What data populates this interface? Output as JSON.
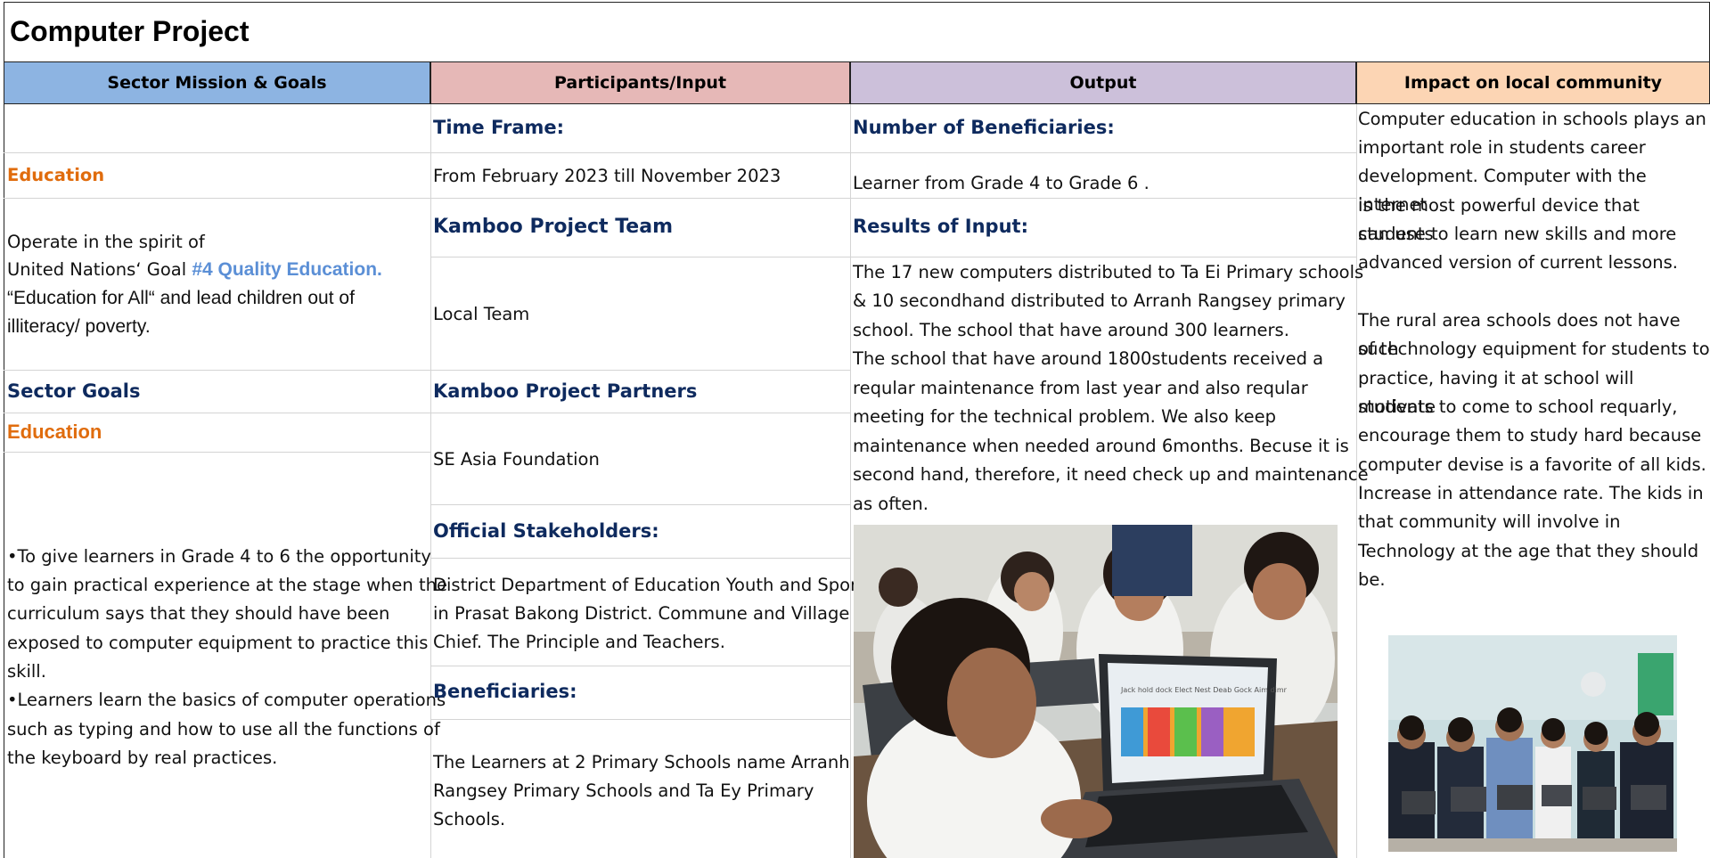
{
  "title": "Computer Project",
  "colors": {
    "header_mission": "#8db4e2",
    "header_participants": "#e6b8b7",
    "header_output": "#ccc0da",
    "header_impact": "#fcd5b4",
    "navy": "#0e2a5e",
    "orange": "#e06c0d",
    "goal_blue": "#5b8fd6"
  },
  "headers": {
    "mission": "Sector Mission & Goals",
    "participants": "Participants/Input",
    "output": "Output",
    "impact": "Impact on local community"
  },
  "mission": {
    "education_label": "Education",
    "spirit_line1": "Operate in the spirit of",
    "spirit_line2_prefix": "United Nations‘ Goal ",
    "spirit_goal": "#4 Quality Education.",
    "spirit_line3": "“Education for All“ and lead children out of",
    "spirit_line4": "illiteracy/ poverty.",
    "sector_goals_label": "Sector Goals",
    "education_label_2": "Education",
    "goals_lines": [
      "•To give learners in Grade 4 to 6 the opportunity",
      "to gain practical experience at the stage when the",
      "curriculum says that they should have been",
      "exposed to computer equipment to practice this",
      "skill.",
      "•Learners learn the basics of computer operations",
      "such as typing and how to use all the functions of",
      "the keyboard by real practices."
    ]
  },
  "participants": {
    "time_frame_label": "Time Frame:",
    "time_frame_value": "From February 2023 till November 2023",
    "team_label": "Kamboo Project Team",
    "team_value": "Local Team",
    "partners_label": "Kamboo Project Partners",
    "partners_value": "SE Asia Foundation",
    "stakeholders_label": "Official Stakeholders:",
    "stakeholders_lines": [
      "District Department of Education Youth and Sport",
      "in Prasat Bakong District. Commune and Village",
      "Chief. The Principle and Teachers."
    ],
    "beneficiaries_label": "Beneficiaries:",
    "beneficiaries_lines": [
      "The Learners at 2 Primary Schools name Arranh",
      "Rangsey Primary Schools and Ta Ey Primary",
      "Schools."
    ]
  },
  "output": {
    "beneficiaries_label": "Number of Beneficiaries:",
    "beneficiaries_value": "Learner from Grade 4 to Grade 6 .",
    "results_label": "Results of Input:",
    "results_lines": [
      "The 17 new computers distributed to Ta Ei Primary schools",
      "& 10 secondhand distributed to Arranh Rangsey primary",
      "school. The school that have around 300 learners.",
      "The school that have around 1800students received a",
      "reqular maintenance from last year and also reqular",
      "meeting for the technical problem. We also keep",
      "maintenance when needed around 6months. Becuse it is",
      "second hand, therefore, it need check up and maintenance",
      "as often."
    ],
    "screen_text": "Jack hold dock Elect Nest Deab Gock Aim dimr"
  },
  "impact": {
    "paragraph1_lines": [
      "Computer education in schools plays an",
      "important role in students career",
      "development. Computer with the internet",
      "is the most powerful device that students",
      "can use to learn new skills and more",
      "advanced version of current lessons."
    ],
    "paragraph2_lines": [
      "The rural area schools does not have such",
      "of technology equipment for students to",
      "practice, having it at school will motivate",
      "students to come to school requarly,",
      "encourage them to study hard because",
      "computer devise is a favorite of all kids.",
      "Increase in attendance rate. The kids in",
      "that community will involve in",
      "Technology at the age that they should",
      "be."
    ]
  }
}
